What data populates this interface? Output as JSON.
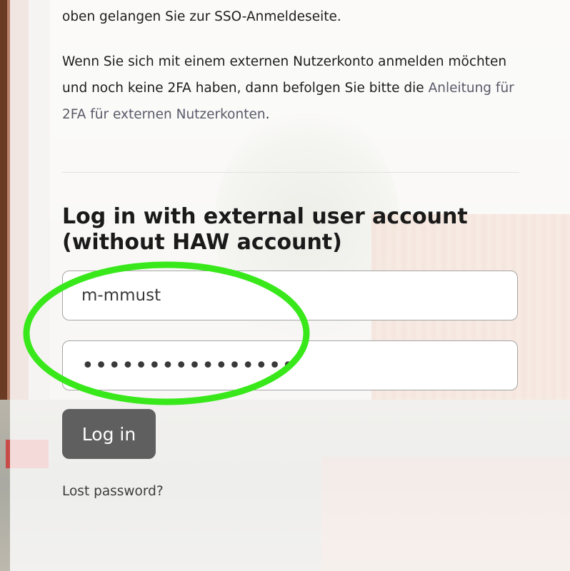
{
  "intro": {
    "line1": "oben gelangen Sie zur SSO-Anmeldeseite.",
    "para_text": "Wenn Sie sich mit einem externen Nutzerkonto anmelden möchten und noch keine 2FA haben, dann befolgen Sie bitte die ",
    "link_text": "Anleitung für 2FA für externen Nutzerkonten",
    "para_end": "."
  },
  "form": {
    "heading": "Log in with external user account (without HAW account)",
    "username_value": "m-mmust",
    "password_value": "••••••••••••••••",
    "login_button": "Log in",
    "lost_password": "Lost password?"
  },
  "colors": {
    "annotation": "#39e81b",
    "button_bg": "#5f5f5f"
  }
}
